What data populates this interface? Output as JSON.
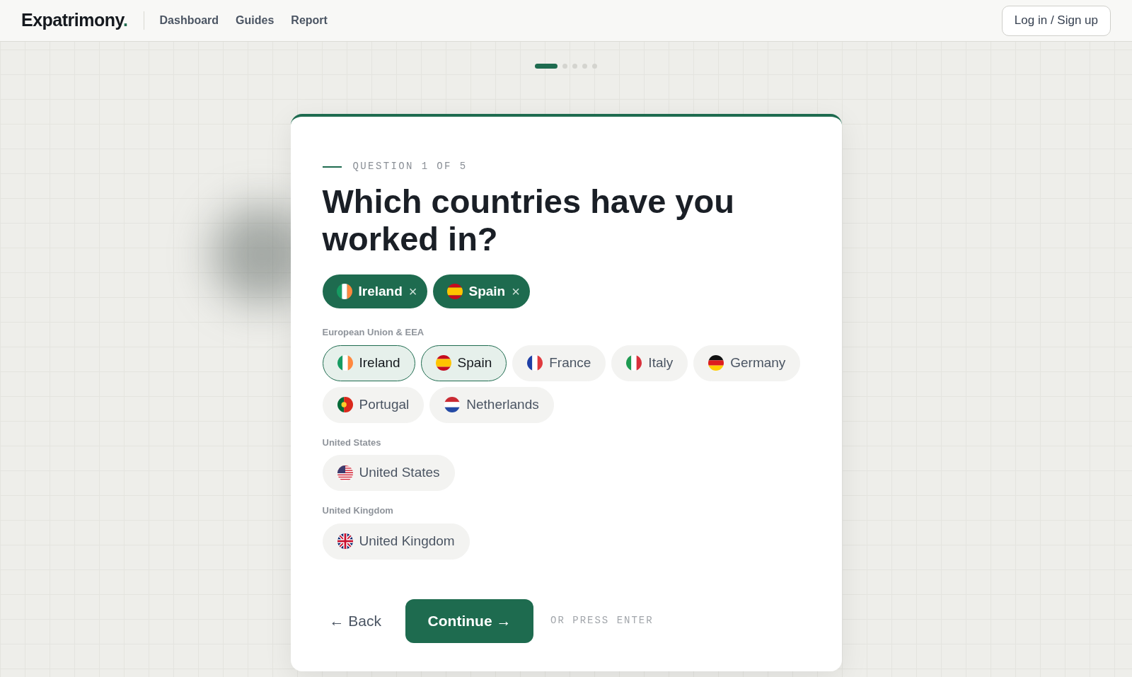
{
  "brand": {
    "name": "Expatrimony",
    "dot": "."
  },
  "nav": [
    {
      "label": "Dashboard"
    },
    {
      "label": "Guides"
    },
    {
      "label": "Report"
    }
  ],
  "login_button": "Log in / Sign up",
  "progress": [
    {
      "selected": true
    },
    {
      "selected": false
    },
    {
      "selected": false
    },
    {
      "selected": false
    },
    {
      "selected": false
    }
  ],
  "question_label": "QUESTION 1 OF 5",
  "title": "Which countries have you worked in?",
  "selected_chips": [
    {
      "label": "Ireland",
      "kind": "ie",
      "remove": "×"
    },
    {
      "label": "Spain",
      "kind": "es",
      "remove": "×"
    }
  ],
  "groups": [
    {
      "label": "European Union & EEA",
      "options": [
        {
          "label": "Ireland",
          "kind": "ie",
          "selected": true
        },
        {
          "label": "Spain",
          "kind": "es",
          "selected": true
        },
        {
          "label": "France",
          "kind": "fr",
          "selected": false
        },
        {
          "label": "Italy",
          "kind": "it",
          "selected": false
        },
        {
          "label": "Germany",
          "kind": "de",
          "selected": false
        },
        {
          "label": "Portugal",
          "kind": "pt",
          "selected": false
        },
        {
          "label": "Netherlands",
          "kind": "nl",
          "selected": false
        }
      ]
    },
    {
      "label": "United States",
      "options": [
        {
          "label": "United States",
          "kind": "us",
          "selected": false
        }
      ]
    },
    {
      "label": "United Kingdom",
      "options": [
        {
          "label": "United Kingdom",
          "kind": "gb",
          "selected": false
        }
      ]
    }
  ],
  "back_button": "← Back",
  "continue_button": "Continue →",
  "hint": "OR PRESS ENTER"
}
